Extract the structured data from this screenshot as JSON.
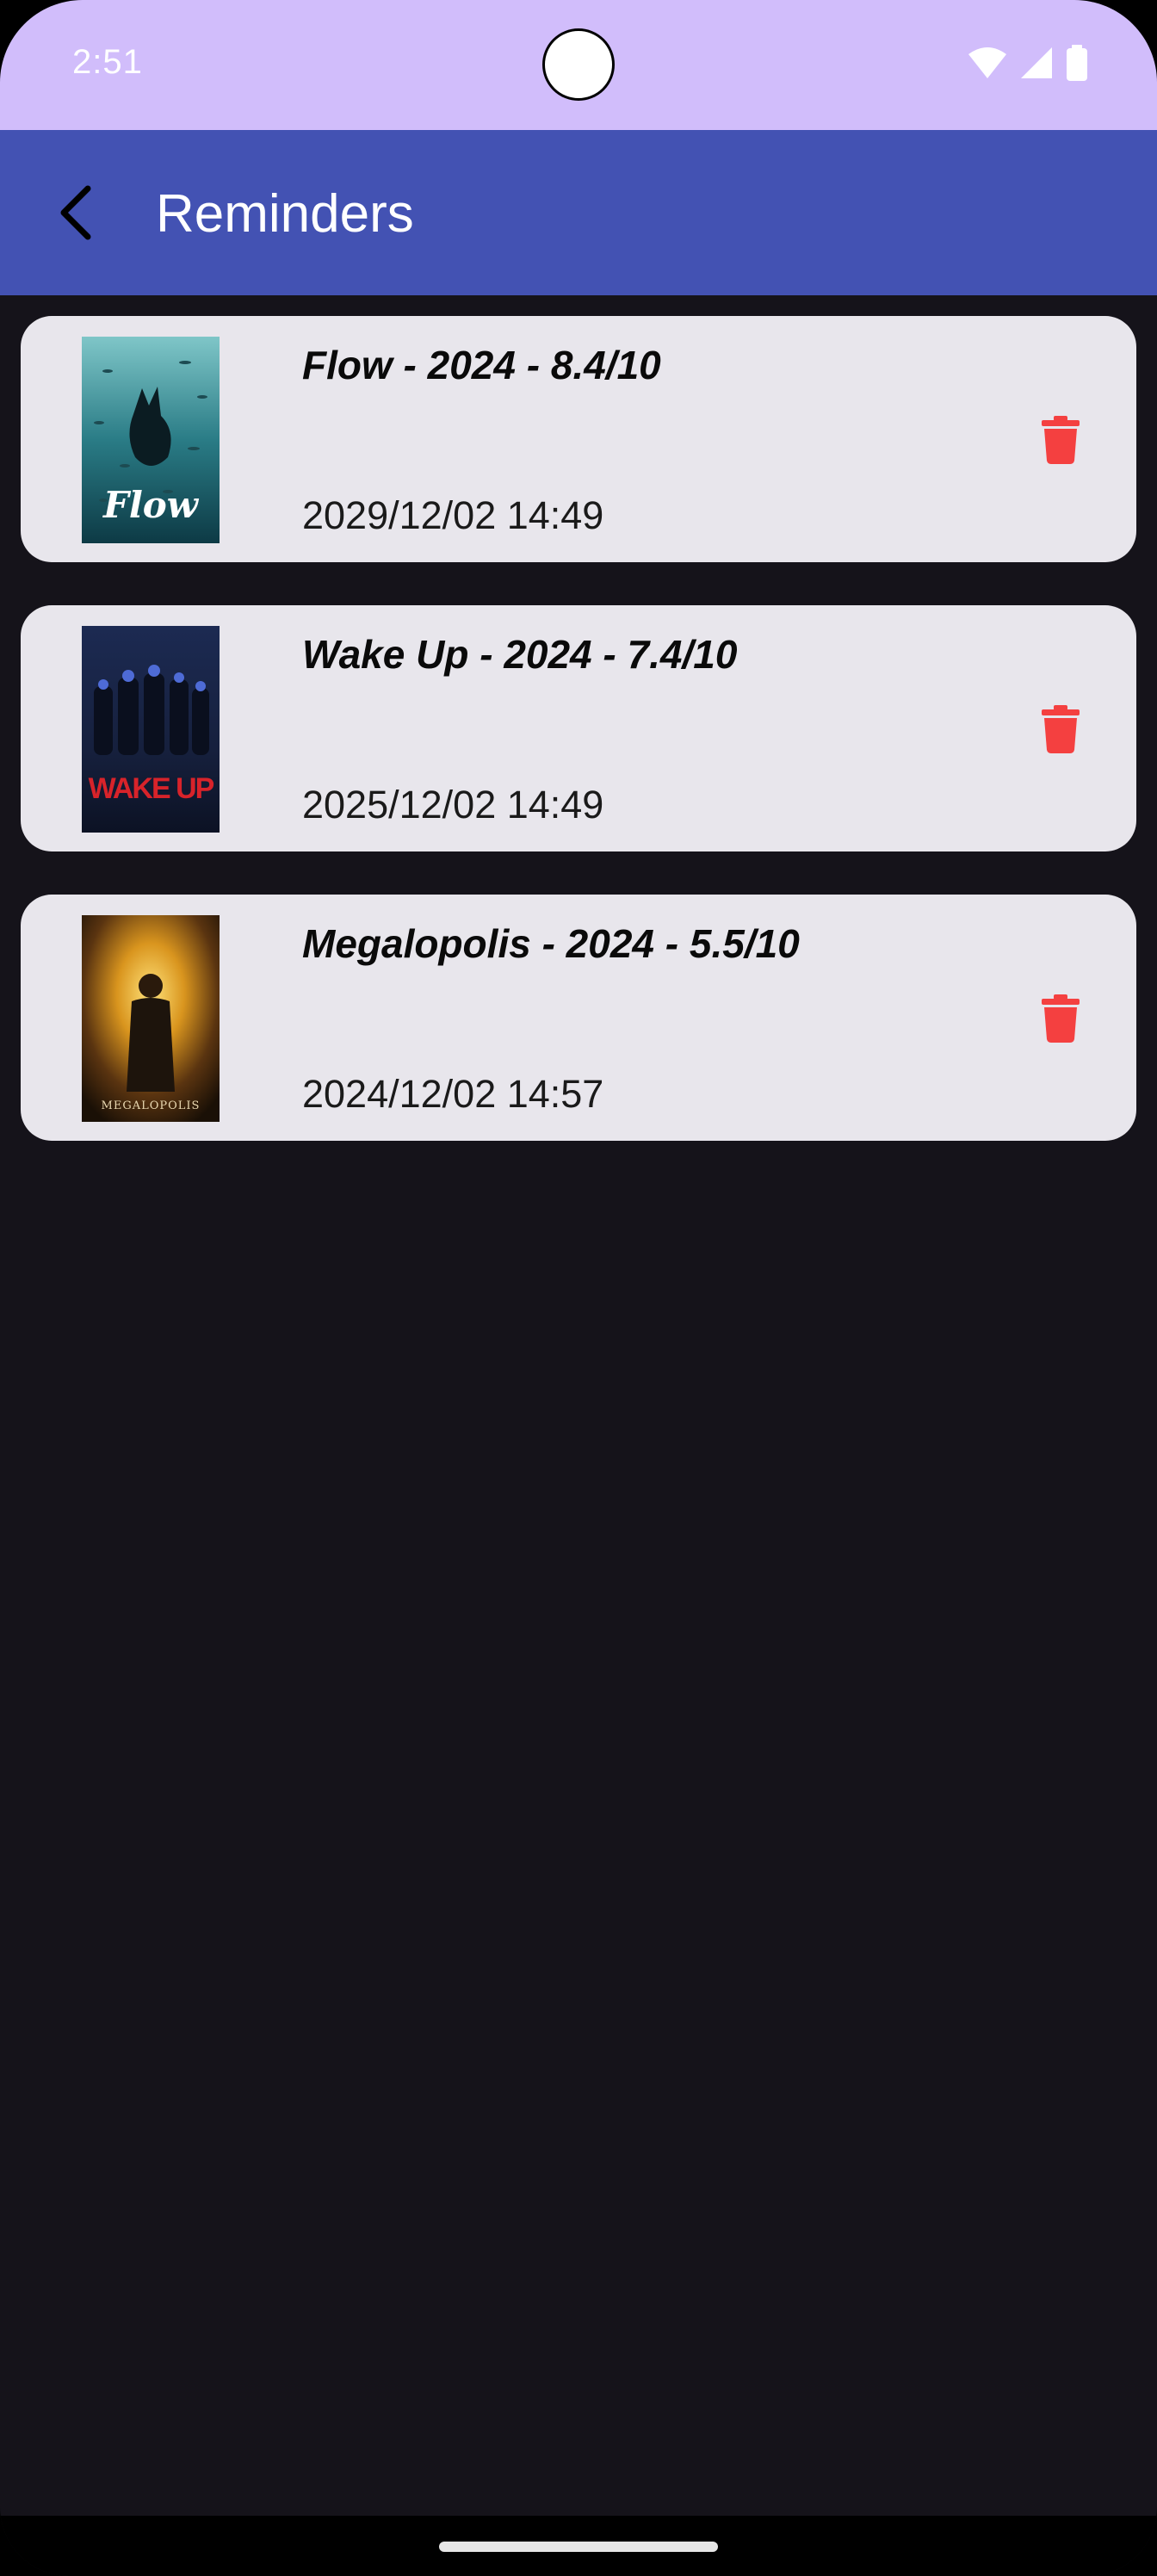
{
  "status_bar": {
    "time": "2:51",
    "icons": [
      "wifi-icon",
      "signal-icon",
      "battery-icon"
    ]
  },
  "app_bar": {
    "title": "Reminders",
    "back_icon": "arrow-back-icon"
  },
  "reminders": [
    {
      "title": "Flow - 2024 - 8.4/10",
      "date": "2029/12/02 14:49",
      "poster_text": "Flow",
      "poster_theme": "underwater"
    },
    {
      "title": "Wake Up - 2024 - 7.4/10",
      "date": "2025/12/02 14:49",
      "poster_text": "WAKE UP",
      "poster_theme": "dark-blue"
    },
    {
      "title": "Megalopolis - 2024 - 5.5/10",
      "date": "2024/12/02 14:57",
      "poster_text": "MEGALOPOLIS",
      "poster_theme": "golden"
    }
  ],
  "colors": {
    "status_bar": "#d1bdfb",
    "app_bar": "#4352b3",
    "background": "#15131a",
    "card": "#e8e6ec",
    "delete": "#f44040"
  }
}
